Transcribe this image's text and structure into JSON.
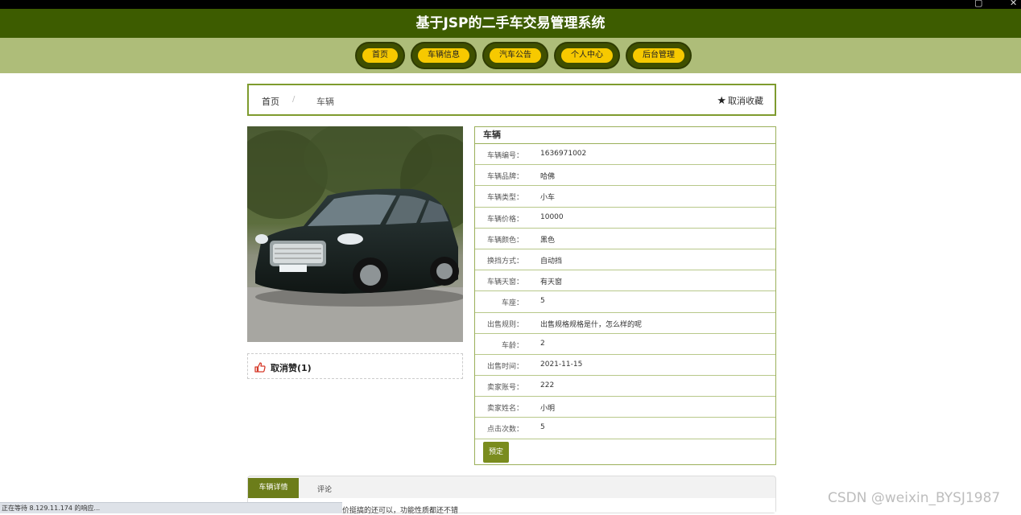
{
  "header": {
    "title": "基于JSP的二手车交易管理系统"
  },
  "nav": [
    {
      "label": "首页"
    },
    {
      "label": "车辆信息"
    },
    {
      "label": "汽车公告"
    },
    {
      "label": "个人中心"
    },
    {
      "label": "后台管理"
    }
  ],
  "breadcrumb": {
    "home": "首页",
    "separator": "/",
    "current": "车辆",
    "favorite": "取消收藏"
  },
  "like": {
    "label": "取消赞(1)"
  },
  "info": {
    "title": "车辆",
    "rows": [
      {
        "label": "车辆编号：",
        "value": "1636971002"
      },
      {
        "label": "车辆品牌：",
        "value": "哈佛"
      },
      {
        "label": "车辆类型：",
        "value": "小车"
      },
      {
        "label": "车辆价格：",
        "value": "10000"
      },
      {
        "label": "车辆颜色：",
        "value": "黑色"
      },
      {
        "label": "换挡方式：",
        "value": "自动挡"
      },
      {
        "label": "车辆天窗：",
        "value": "有天窗"
      },
      {
        "label": "车座：",
        "value": "5"
      },
      {
        "label": "出售规则：",
        "value": "出售规格规格是什，怎么样的呢"
      },
      {
        "label": "车龄：",
        "value": "2"
      },
      {
        "label": "出售时间：",
        "value": "2021-11-15"
      },
      {
        "label": "卖家账号：",
        "value": "222"
      },
      {
        "label": "卖家姓名：",
        "value": "小明"
      },
      {
        "label": "点击次数：",
        "value": "5"
      }
    ],
    "book_button": "预定"
  },
  "tabs": {
    "active": "车辆详情",
    "other": "评论",
    "content_fragment": "价挺搞的还可以，功能性质都还不错"
  },
  "status_bar": "正在等待 8.129.11.174 的响应...",
  "watermark": "CSDN @weixin_BYSJ1987",
  "colors": {
    "header": "#3d5c00",
    "navbar": "#aebd79",
    "nav_pill": "#f7c900",
    "accent": "#7a8c1e"
  }
}
